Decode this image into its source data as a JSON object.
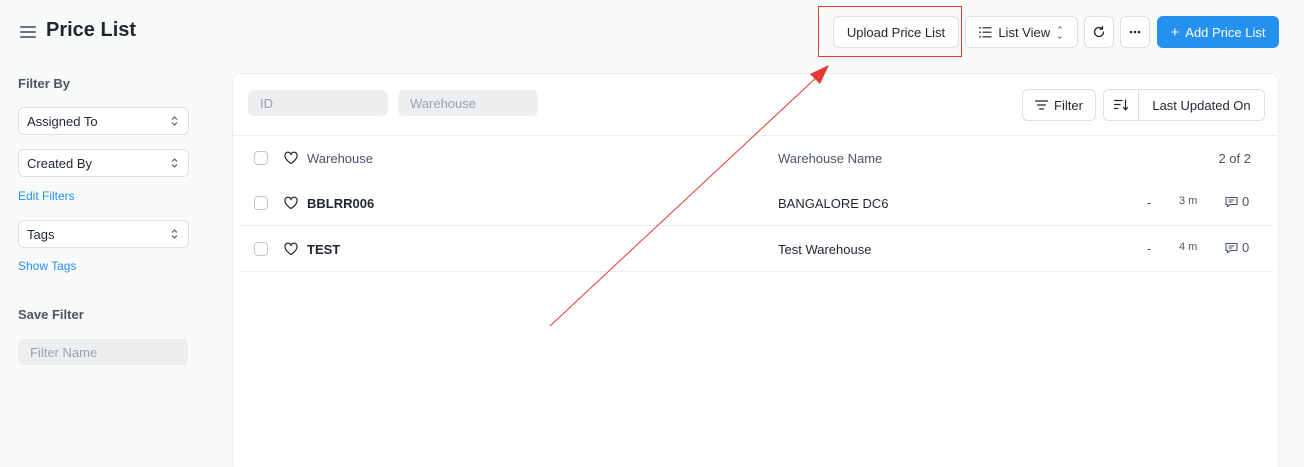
{
  "header": {
    "title": "Price List",
    "upload_label": "Upload Price List",
    "list_view_label": "List View",
    "add_label": "Add Price List"
  },
  "sidebar": {
    "filter_by": "Filter By",
    "assigned_to": "Assigned To",
    "created_by": "Created By",
    "edit_filters": "Edit Filters",
    "tags": "Tags",
    "show_tags": "Show Tags",
    "save_filter": "Save Filter",
    "filter_name_placeholder": "Filter Name"
  },
  "toolbar": {
    "id_placeholder": "ID",
    "warehouse_placeholder": "Warehouse",
    "filter_label": "Filter",
    "sort_label": "Last Updated On"
  },
  "table": {
    "header": {
      "name": "Warehouse",
      "warehouse_name": "Warehouse Name",
      "count": "2 of 2"
    },
    "rows": [
      {
        "name": "BBLRR006",
        "warehouse_name": "BANGALORE DC6",
        "modified_by": "-",
        "time": "3 m",
        "comments": "0"
      },
      {
        "name": "TEST",
        "warehouse_name": "Test Warehouse",
        "modified_by": "-",
        "time": "4 m",
        "comments": "0"
      }
    ]
  },
  "colors": {
    "primary": "#2490ef",
    "annotation": "#e53935"
  },
  "icons": [
    "hamburger-icon",
    "list-icon",
    "refresh-icon",
    "more-icon",
    "plus-icon",
    "filter-icon",
    "sort-icon",
    "heart-icon",
    "comment-icon"
  ]
}
